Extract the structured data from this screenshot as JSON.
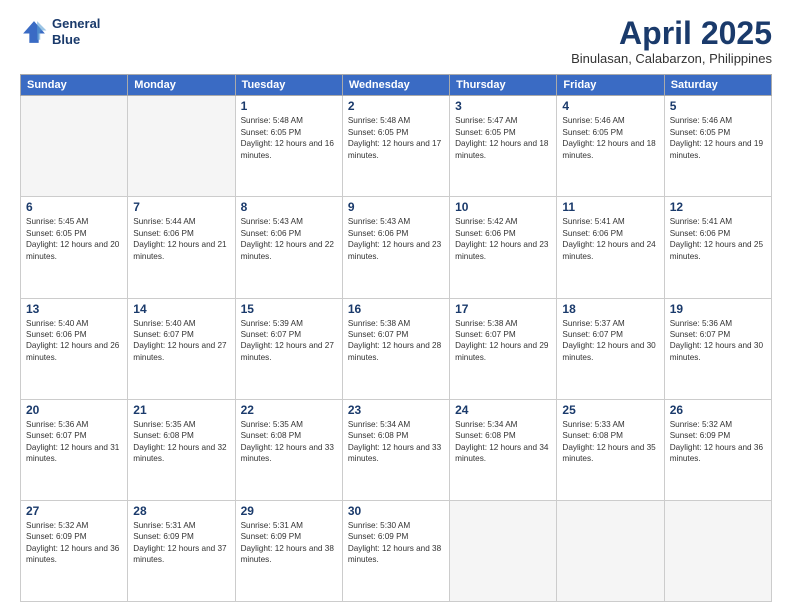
{
  "header": {
    "logo_line1": "General",
    "logo_line2": "Blue",
    "title": "April 2025",
    "subtitle": "Binulasan, Calabarzon, Philippines"
  },
  "weekdays": [
    "Sunday",
    "Monday",
    "Tuesday",
    "Wednesday",
    "Thursday",
    "Friday",
    "Saturday"
  ],
  "weeks": [
    [
      {
        "day": "",
        "info": ""
      },
      {
        "day": "",
        "info": ""
      },
      {
        "day": "1",
        "info": "Sunrise: 5:48 AM\nSunset: 6:05 PM\nDaylight: 12 hours and 16 minutes."
      },
      {
        "day": "2",
        "info": "Sunrise: 5:48 AM\nSunset: 6:05 PM\nDaylight: 12 hours and 17 minutes."
      },
      {
        "day": "3",
        "info": "Sunrise: 5:47 AM\nSunset: 6:05 PM\nDaylight: 12 hours and 18 minutes."
      },
      {
        "day": "4",
        "info": "Sunrise: 5:46 AM\nSunset: 6:05 PM\nDaylight: 12 hours and 18 minutes."
      },
      {
        "day": "5",
        "info": "Sunrise: 5:46 AM\nSunset: 6:05 PM\nDaylight: 12 hours and 19 minutes."
      }
    ],
    [
      {
        "day": "6",
        "info": "Sunrise: 5:45 AM\nSunset: 6:05 PM\nDaylight: 12 hours and 20 minutes."
      },
      {
        "day": "7",
        "info": "Sunrise: 5:44 AM\nSunset: 6:06 PM\nDaylight: 12 hours and 21 minutes."
      },
      {
        "day": "8",
        "info": "Sunrise: 5:43 AM\nSunset: 6:06 PM\nDaylight: 12 hours and 22 minutes."
      },
      {
        "day": "9",
        "info": "Sunrise: 5:43 AM\nSunset: 6:06 PM\nDaylight: 12 hours and 23 minutes."
      },
      {
        "day": "10",
        "info": "Sunrise: 5:42 AM\nSunset: 6:06 PM\nDaylight: 12 hours and 23 minutes."
      },
      {
        "day": "11",
        "info": "Sunrise: 5:41 AM\nSunset: 6:06 PM\nDaylight: 12 hours and 24 minutes."
      },
      {
        "day": "12",
        "info": "Sunrise: 5:41 AM\nSunset: 6:06 PM\nDaylight: 12 hours and 25 minutes."
      }
    ],
    [
      {
        "day": "13",
        "info": "Sunrise: 5:40 AM\nSunset: 6:06 PM\nDaylight: 12 hours and 26 minutes."
      },
      {
        "day": "14",
        "info": "Sunrise: 5:40 AM\nSunset: 6:07 PM\nDaylight: 12 hours and 27 minutes."
      },
      {
        "day": "15",
        "info": "Sunrise: 5:39 AM\nSunset: 6:07 PM\nDaylight: 12 hours and 27 minutes."
      },
      {
        "day": "16",
        "info": "Sunrise: 5:38 AM\nSunset: 6:07 PM\nDaylight: 12 hours and 28 minutes."
      },
      {
        "day": "17",
        "info": "Sunrise: 5:38 AM\nSunset: 6:07 PM\nDaylight: 12 hours and 29 minutes."
      },
      {
        "day": "18",
        "info": "Sunrise: 5:37 AM\nSunset: 6:07 PM\nDaylight: 12 hours and 30 minutes."
      },
      {
        "day": "19",
        "info": "Sunrise: 5:36 AM\nSunset: 6:07 PM\nDaylight: 12 hours and 30 minutes."
      }
    ],
    [
      {
        "day": "20",
        "info": "Sunrise: 5:36 AM\nSunset: 6:07 PM\nDaylight: 12 hours and 31 minutes."
      },
      {
        "day": "21",
        "info": "Sunrise: 5:35 AM\nSunset: 6:08 PM\nDaylight: 12 hours and 32 minutes."
      },
      {
        "day": "22",
        "info": "Sunrise: 5:35 AM\nSunset: 6:08 PM\nDaylight: 12 hours and 33 minutes."
      },
      {
        "day": "23",
        "info": "Sunrise: 5:34 AM\nSunset: 6:08 PM\nDaylight: 12 hours and 33 minutes."
      },
      {
        "day": "24",
        "info": "Sunrise: 5:34 AM\nSunset: 6:08 PM\nDaylight: 12 hours and 34 minutes."
      },
      {
        "day": "25",
        "info": "Sunrise: 5:33 AM\nSunset: 6:08 PM\nDaylight: 12 hours and 35 minutes."
      },
      {
        "day": "26",
        "info": "Sunrise: 5:32 AM\nSunset: 6:09 PM\nDaylight: 12 hours and 36 minutes."
      }
    ],
    [
      {
        "day": "27",
        "info": "Sunrise: 5:32 AM\nSunset: 6:09 PM\nDaylight: 12 hours and 36 minutes."
      },
      {
        "day": "28",
        "info": "Sunrise: 5:31 AM\nSunset: 6:09 PM\nDaylight: 12 hours and 37 minutes."
      },
      {
        "day": "29",
        "info": "Sunrise: 5:31 AM\nSunset: 6:09 PM\nDaylight: 12 hours and 38 minutes."
      },
      {
        "day": "30",
        "info": "Sunrise: 5:30 AM\nSunset: 6:09 PM\nDaylight: 12 hours and 38 minutes."
      },
      {
        "day": "",
        "info": ""
      },
      {
        "day": "",
        "info": ""
      },
      {
        "day": "",
        "info": ""
      }
    ]
  ]
}
